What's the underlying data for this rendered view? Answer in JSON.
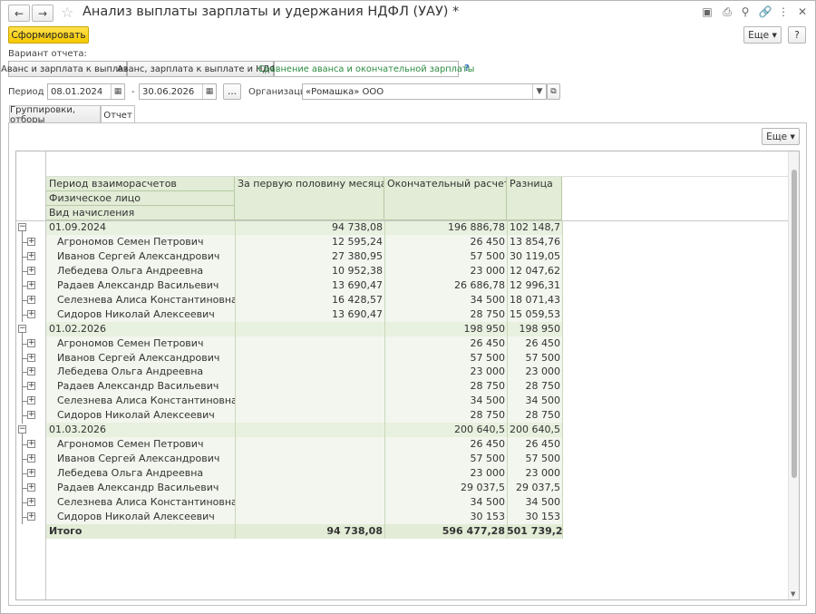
{
  "window": {
    "title": "Анализ выплаты зарплаты и удержания НДФЛ (УАУ) *"
  },
  "toolbar": {
    "generate_label": "Сформировать",
    "more_label": "Еще",
    "help_label": "?"
  },
  "variant": {
    "label": "Вариант отчета:",
    "options": [
      "Аванс и зарплата к выплате",
      "Аванс, зарплата к выплате и НДФЛ",
      "Сравнение аванса и окончательной зарплаты"
    ],
    "selected": "Сравнение аванса и окончательной зарплаты",
    "help": "?"
  },
  "period": {
    "label": "Период :",
    "from": "08.01.2024",
    "dash": "-",
    "to": "30.06.2026",
    "dots": "..."
  },
  "organization": {
    "label": "Организация:",
    "value": "«Ромашка» ООО"
  },
  "tabs": [
    "Группировки, отборы",
    "Отчет"
  ],
  "report": {
    "more_label": "Еще",
    "headers": {
      "group1": "Период взаиморасчетов",
      "group2": "Физическое лицо",
      "group3": "Вид начисления",
      "col1": "За первую половину месяца",
      "col2": "Окончательный расчет",
      "col3": "Разница"
    },
    "groups": [
      {
        "period": "01.09.2024",
        "first_half": "94 738,08",
        "final": "196 886,78",
        "diff": "102 148,7",
        "rows": [
          {
            "name": "Агрономов Семен Петрович",
            "first_half": "12 595,24",
            "final": "26 450",
            "diff": "13 854,76"
          },
          {
            "name": "Иванов Сергей Александрович",
            "first_half": "27 380,95",
            "final": "57 500",
            "diff": "30 119,05"
          },
          {
            "name": "Лебедева Ольга Андреевна",
            "first_half": "10 952,38",
            "final": "23 000",
            "diff": "12 047,62"
          },
          {
            "name": "Радаев Александр Васильевич",
            "first_half": "13 690,47",
            "final": "26 686,78",
            "diff": "12 996,31"
          },
          {
            "name": "Селезнева Алиса Константиновна",
            "first_half": "16 428,57",
            "final": "34 500",
            "diff": "18 071,43"
          },
          {
            "name": "Сидоров Николай Алексеевич",
            "first_half": "13 690,47",
            "final": "28 750",
            "diff": "15 059,53"
          }
        ]
      },
      {
        "period": "01.02.2026",
        "first_half": "",
        "final": "198 950",
        "diff": "198 950",
        "rows": [
          {
            "name": "Агрономов Семен Петрович",
            "first_half": "",
            "final": "26 450",
            "diff": "26 450"
          },
          {
            "name": "Иванов Сергей Александрович",
            "first_half": "",
            "final": "57 500",
            "diff": "57 500"
          },
          {
            "name": "Лебедева Ольга Андреевна",
            "first_half": "",
            "final": "23 000",
            "diff": "23 000"
          },
          {
            "name": "Радаев Александр Васильевич",
            "first_half": "",
            "final": "28 750",
            "diff": "28 750"
          },
          {
            "name": "Селезнева Алиса Константиновна",
            "first_half": "",
            "final": "34 500",
            "diff": "34 500"
          },
          {
            "name": "Сидоров Николай Алексеевич",
            "first_half": "",
            "final": "28 750",
            "diff": "28 750"
          }
        ]
      },
      {
        "period": "01.03.2026",
        "first_half": "",
        "final": "200 640,5",
        "diff": "200 640,5",
        "rows": [
          {
            "name": "Агрономов Семен Петрович",
            "first_half": "",
            "final": "26 450",
            "diff": "26 450"
          },
          {
            "name": "Иванов Сергей Александрович",
            "first_half": "",
            "final": "57 500",
            "diff": "57 500"
          },
          {
            "name": "Лебедева Ольга Андреевна",
            "first_half": "",
            "final": "23 000",
            "diff": "23 000"
          },
          {
            "name": "Радаев Александр Васильевич",
            "first_half": "",
            "final": "29 037,5",
            "diff": "29 037,5"
          },
          {
            "name": "Селезнева Алиса Константиновна",
            "first_half": "",
            "final": "34 500",
            "diff": "34 500"
          },
          {
            "name": "Сидоров Николай Алексеевич",
            "first_half": "",
            "final": "30 153",
            "diff": "30 153"
          }
        ]
      }
    ],
    "total": {
      "label": "Итого",
      "first_half": "94 738,08",
      "final": "596 477,28",
      "diff": "501 739,2"
    }
  }
}
